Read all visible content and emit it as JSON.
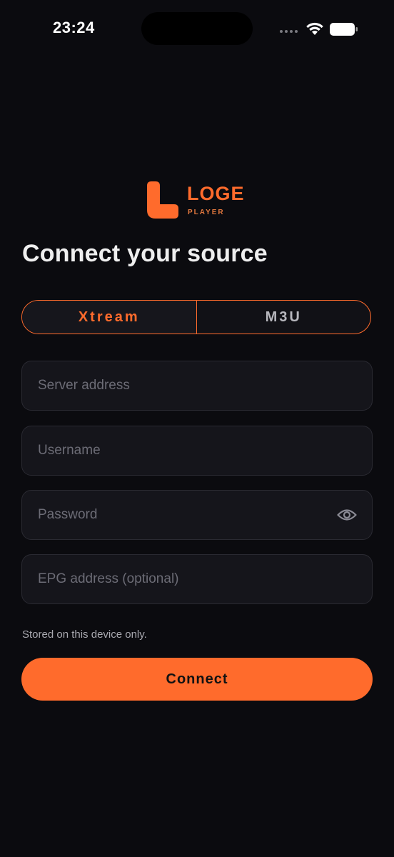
{
  "status_bar": {
    "time": "23:24"
  },
  "brand": {
    "name": "LOGE",
    "tagline": "PLAYER",
    "accent_color": "#ff6b2c"
  },
  "page_title": "Connect your source",
  "source_tabs": [
    {
      "label": "Xtream",
      "active": true
    },
    {
      "label": "M3U",
      "active": false
    }
  ],
  "form": {
    "server": {
      "placeholder": "Server address",
      "value": ""
    },
    "username": {
      "placeholder": "Username",
      "value": ""
    },
    "password": {
      "placeholder": "Password",
      "value": "",
      "toggle_icon": "eye-icon"
    },
    "epg": {
      "placeholder": "EPG address (optional)",
      "value": ""
    }
  },
  "storage_note": "Stored on this device only.",
  "connect_label": "Connect",
  "icons": [
    "signal-icon",
    "wifi-icon",
    "battery-icon",
    "eye-icon",
    "loge-logo-mark"
  ]
}
